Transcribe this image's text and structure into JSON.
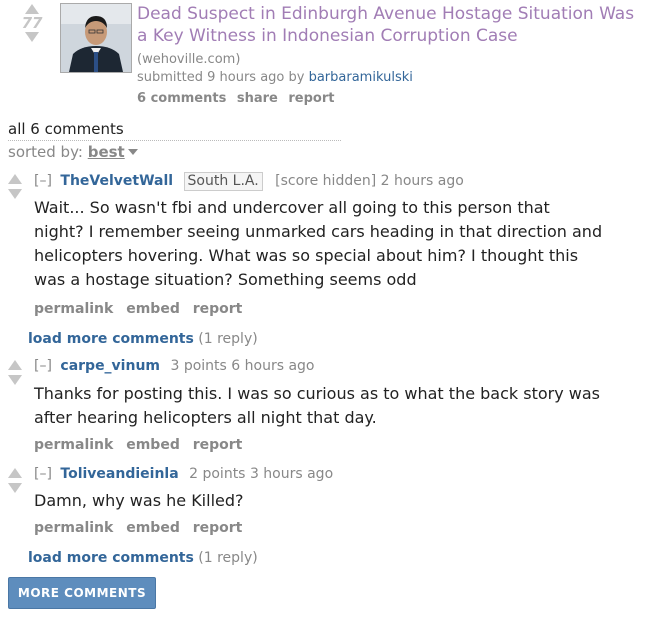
{
  "post": {
    "score": "77",
    "title": "Dead Suspect in Edinburgh Avenue Hostage Situation Was a Key Witness in Indonesian Corruption Case",
    "domain": "(wehoville.com)",
    "submitted_prefix": "submitted 9 hours ago by",
    "author": "barbaramikulski",
    "buttons": [
      "6 comments",
      "share",
      "report"
    ],
    "colors": {
      "title": "#a17db5",
      "link": "#336699"
    }
  },
  "comments_header": {
    "all_label": "all 6 comments",
    "sorted_label": "sorted by:",
    "sort_value": "best"
  },
  "comments": [
    {
      "toggle": "[–]",
      "author": "TheVelvetWall",
      "flair": "South L.A.",
      "score": "[score hidden]",
      "time": "2 hours ago",
      "lines": [
        "Wait... So wasn't fbi and undercover all going to this person that",
        "night? I remember seeing unmarked cars heading in that direction and",
        "helicopters hovering. What was so special about him? I thought this",
        "was a hostage situation? Something seems odd"
      ],
      "buttons": [
        "permalink",
        "embed",
        "report"
      ],
      "load_more": "load more comments",
      "replies": "(1 reply)"
    },
    {
      "toggle": "[–]",
      "author": "carpe_vinum",
      "score": "3 points",
      "time": "6 hours ago",
      "lines": [
        "Thanks for posting this. I was so curious as to what the back story was",
        "after hearing helicopters all night that day."
      ],
      "buttons": [
        "permalink",
        "embed",
        "report"
      ]
    },
    {
      "toggle": "[–]",
      "author": "Toliveandieinla",
      "score": "2 points",
      "time": "3 hours ago",
      "lines": [
        "Damn, why was he Killed?"
      ],
      "buttons": [
        "permalink",
        "embed",
        "report"
      ],
      "load_more": "load more comments",
      "replies": "(1 reply)"
    }
  ],
  "more_comments_button": "MORE COMMENTS"
}
